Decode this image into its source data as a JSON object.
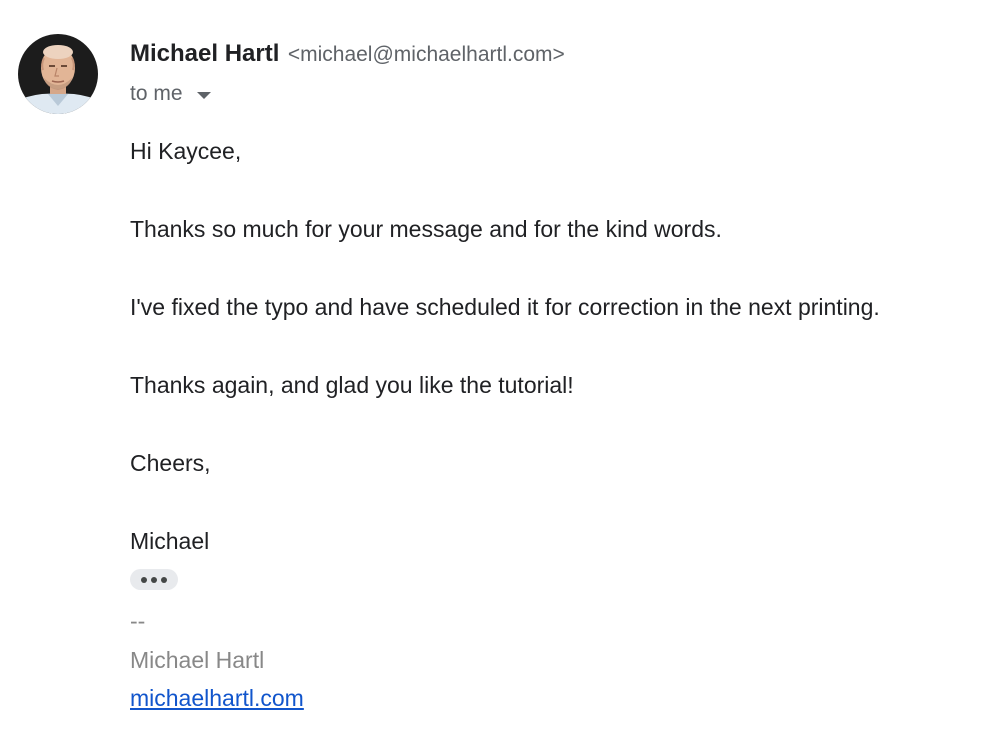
{
  "sender": {
    "name": "Michael Hartl",
    "email": "<michael@michaelhartl.com>",
    "avatar_alt": "avatar"
  },
  "recipient": {
    "label": "to me",
    "icon": "chevron-down-icon"
  },
  "body": {
    "paragraphs": [
      "Hi Kaycee,",
      "Thanks so much for your message and for the kind words.",
      "I've fixed the typo and have scheduled it for correction in the next printing.",
      "Thanks again, and glad you like the tutorial!",
      "Cheers,",
      "Michael"
    ]
  },
  "trimmed_content": {
    "icon": "more-horiz-icon"
  },
  "signature": {
    "dash": "--",
    "name": "Michael Hartl",
    "link": "michaelhartl.com"
  },
  "colors": {
    "link": "#1155cc",
    "muted": "#5f6368",
    "signature": "#888888",
    "text": "#202124"
  }
}
